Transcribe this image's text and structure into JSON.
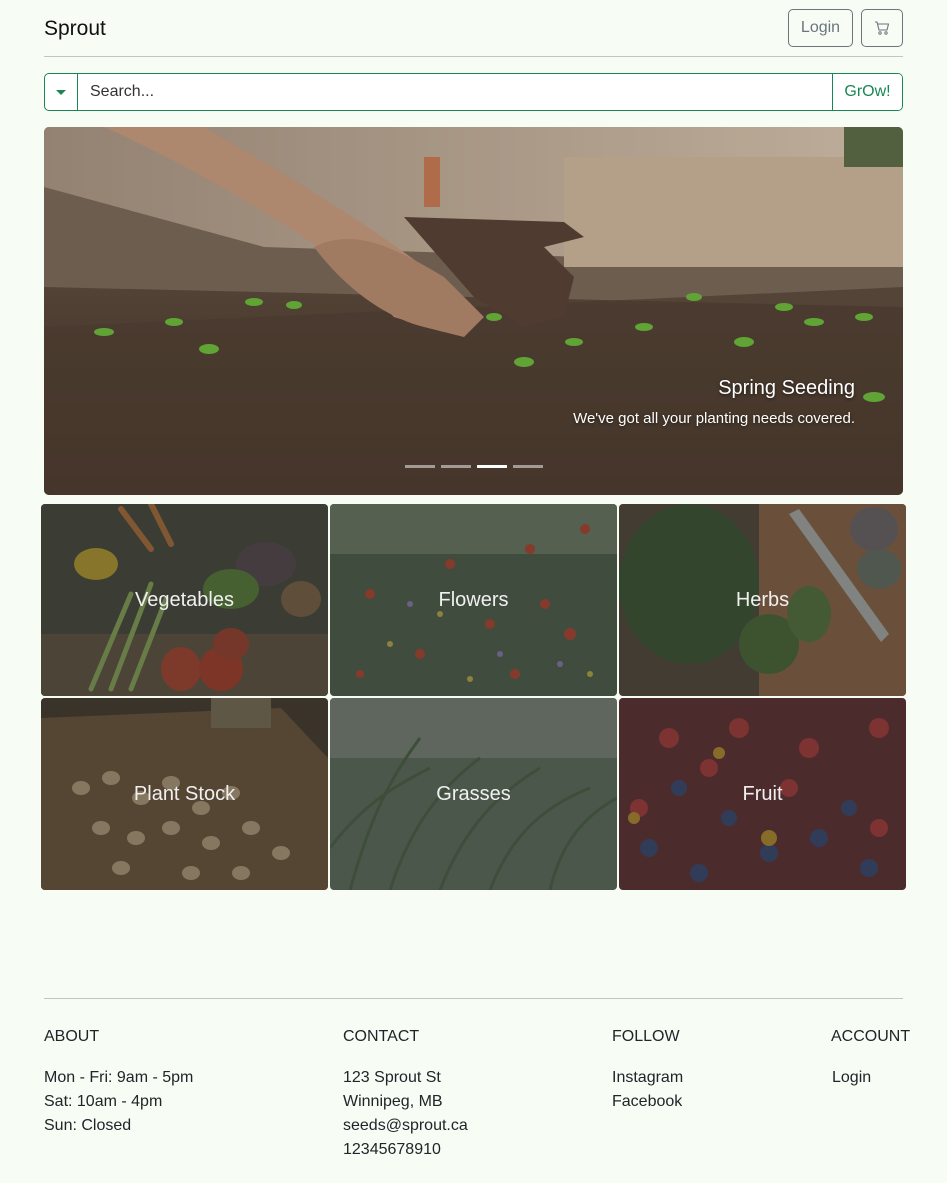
{
  "navbar": {
    "brand": "Sprout",
    "login_label": "Login",
    "cart_icon": "cart-icon"
  },
  "search": {
    "placeholder": "Search...",
    "dropdown_icon": "caret-down-icon",
    "button_label": "GrOw!"
  },
  "carousel": {
    "slide_title": "Spring Seeding",
    "slide_text": "We've got all your planting needs covered.",
    "indicator_count": 4,
    "active_indicator": 3
  },
  "categories": [
    {
      "label": "Vegetables"
    },
    {
      "label": "Flowers"
    },
    {
      "label": "Herbs"
    },
    {
      "label": "Plant Stock"
    },
    {
      "label": "Grasses"
    },
    {
      "label": "Fruit"
    }
  ],
  "footer": {
    "about": {
      "heading": "ABOUT",
      "lines": [
        "Mon - Fri: 9am - 5pm",
        "Sat: 10am - 4pm",
        "Sun: Closed"
      ]
    },
    "contact": {
      "heading": "CONTACT",
      "lines": [
        "123 Sprout St",
        "Winnipeg, MB",
        "seeds@sprout.ca",
        "12345678910"
      ]
    },
    "follow": {
      "heading": "FOLLOW",
      "links": [
        "Instagram",
        "Facebook"
      ]
    },
    "account": {
      "heading": "ACCOUNT",
      "links": [
        "Login"
      ]
    }
  },
  "colors": {
    "accent": "#198754",
    "page_background": "#f7fcf5",
    "outline_gray": "#6c757d"
  }
}
